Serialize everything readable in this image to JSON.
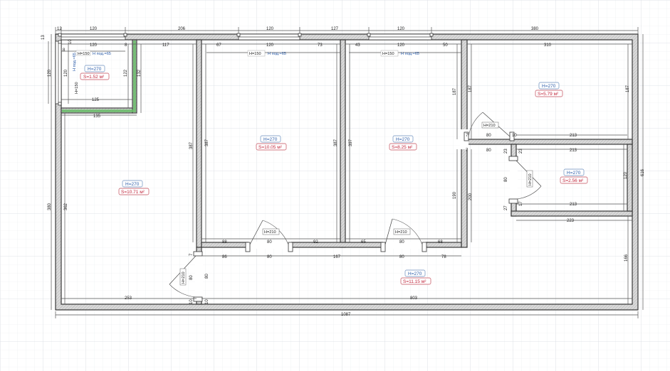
{
  "rooms": [
    {
      "height_label": "H=270",
      "area_label": "S=1.52 м²",
      "note_a": "H=150",
      "note_b": "H под.=65"
    },
    {
      "height_label": "H=270",
      "area_label": "S=10.71 м²"
    },
    {
      "height_label": "H=270",
      "area_label": "S=10.05 м²",
      "note_a": "H=150",
      "note_b": "H под.=65"
    },
    {
      "height_label": "H=270",
      "area_label": "S=8.25 м²",
      "note_a": "H=150",
      "note_b": "H под.=65"
    },
    {
      "height_label": "H=270",
      "area_label": "S=5.79 м²"
    },
    {
      "height_label": "H=270",
      "area_label": "S=2.56 м²"
    },
    {
      "height_label": "H=270",
      "area_label": "S=11.15 м²"
    }
  ],
  "window_left_notes": {
    "vertical_a": "H=150",
    "vertical_b": "H под.=65"
  },
  "doors": [
    "H=210",
    "H=210",
    "H=210",
    "H=210",
    "H=210"
  ],
  "dimensions": {
    "top": [
      "12",
      "120",
      "206",
      "120",
      "127",
      "120",
      "380"
    ],
    "top_inner": [
      "120",
      "8",
      "117",
      "67",
      "120",
      "73",
      "43",
      "120",
      "50",
      "310"
    ],
    "left_outer": [
      "13",
      "120",
      "380"
    ],
    "left_inner": [
      "10",
      "120",
      "362"
    ],
    "room1": [
      "122",
      "132",
      "125",
      "135",
      "8"
    ],
    "verticals": [
      "387",
      "387",
      "387",
      "397",
      "187",
      "187",
      "190",
      "200",
      "166",
      "120",
      "616"
    ],
    "inner_h": [
      "88",
      "80",
      "92",
      "65",
      "80",
      "68",
      "86",
      "80",
      "167",
      "80",
      "78"
    ],
    "right": [
      "213",
      "213",
      "213",
      "223",
      "80",
      "80",
      "7",
      "7",
      "10",
      "17",
      "23",
      "23",
      "27",
      "80"
    ],
    "bottom": [
      "253",
      "803",
      "1087"
    ],
    "door_left": [
      "80",
      "80",
      "10",
      "10",
      "7"
    ]
  }
}
